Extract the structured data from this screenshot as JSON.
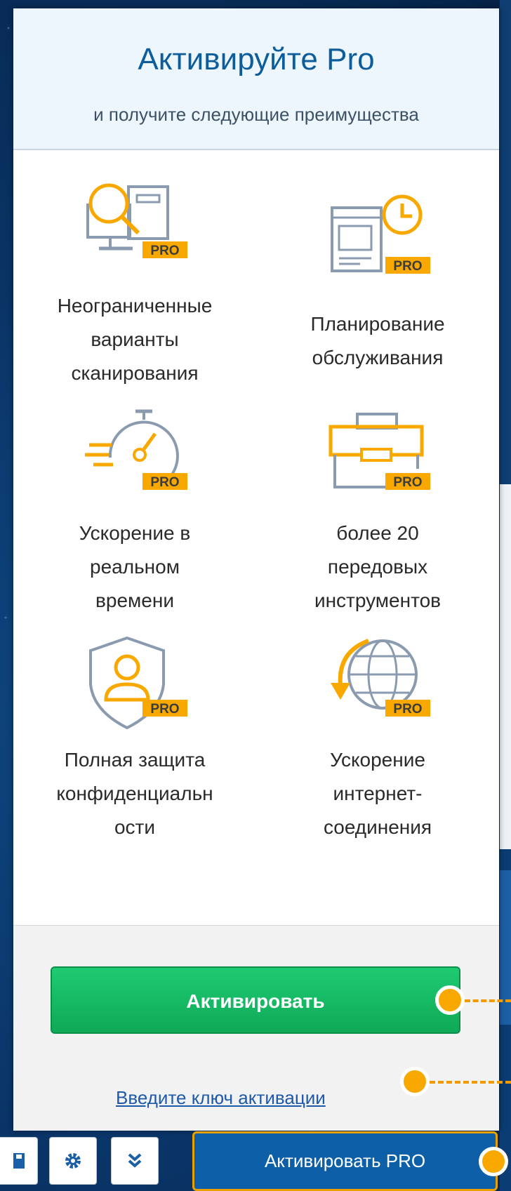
{
  "header": {
    "title": "Активируйте Pro",
    "subtitle": "и получите следующие преимущества"
  },
  "badge_text": "PRO",
  "features": [
    {
      "label_lines": [
        "Неограниченные",
        "варианты",
        "сканирования"
      ],
      "icon": "scan-monitor-icon"
    },
    {
      "label_lines": [
        "Планирование",
        "обслуживания"
      ],
      "icon": "schedule-clock-icon"
    },
    {
      "label_lines": [
        "Ускорение в",
        "реальном",
        "времени"
      ],
      "icon": "stopwatch-speed-icon"
    },
    {
      "label_lines": [
        "более 20",
        "передовых",
        "инструментов"
      ],
      "icon": "toolbox-icon"
    },
    {
      "label_lines": [
        "Полная защита",
        "конфиденциальн",
        "ости"
      ],
      "icon": "shield-user-icon"
    },
    {
      "label_lines": [
        "Ускорение",
        "интернет-",
        "соединения"
      ],
      "icon": "globe-arrow-icon"
    }
  ],
  "footer": {
    "activate_label": "Активировать",
    "key_link": "Введите ключ активации"
  },
  "toolbar": {
    "pro_button": "Активировать PRO",
    "icons": [
      "save-icon",
      "gear-icon",
      "chevron-double-down-icon"
    ]
  },
  "colors": {
    "accent_orange": "#f9a800",
    "icon_gray": "#8a9bb0",
    "title_blue": "#0d5d9c",
    "green": "#12b860",
    "pro_blue": "#0d5fa8"
  }
}
